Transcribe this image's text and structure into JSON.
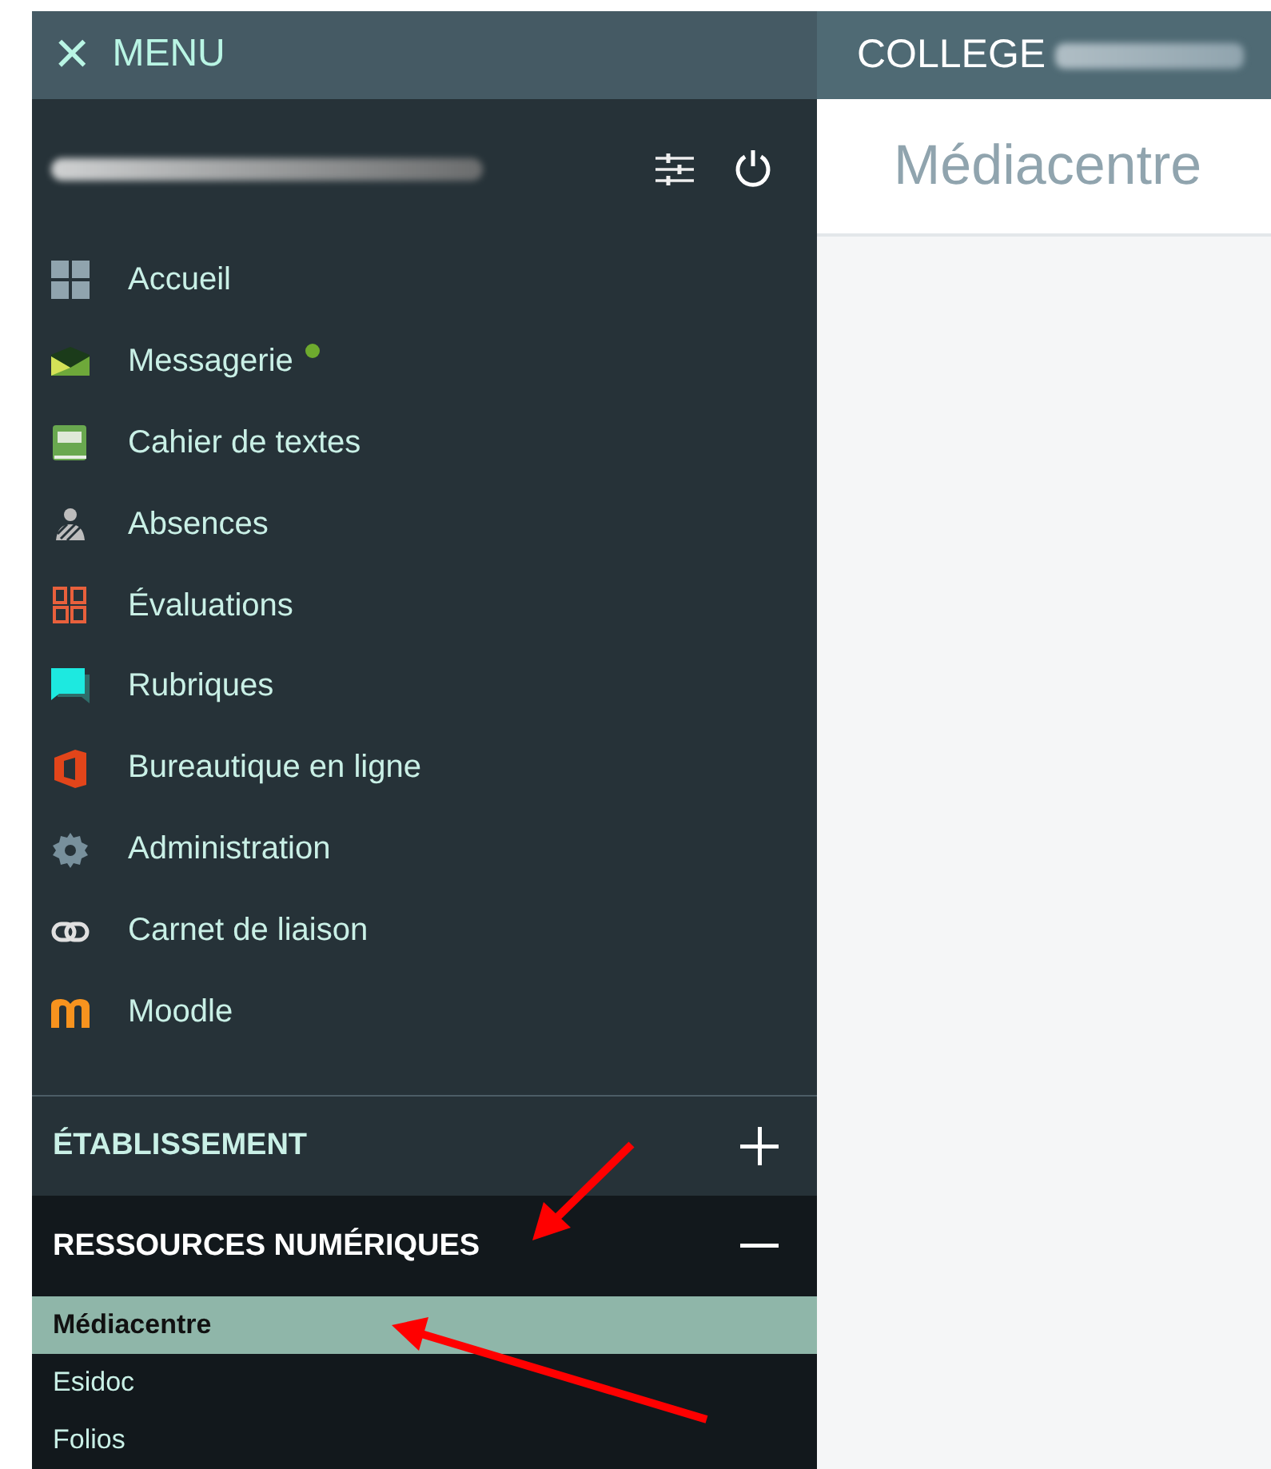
{
  "menu_bar": {
    "close_icon": "×",
    "label": "MENU"
  },
  "header": {
    "school_prefix": "COLLEGE"
  },
  "nav_items": [
    {
      "label": "Accueil",
      "notification": false
    },
    {
      "label": "Messagerie",
      "notification": true
    },
    {
      "label": "Cahier de textes",
      "notification": false
    },
    {
      "label": "Absences",
      "notification": false
    },
    {
      "label": "Évaluations",
      "notification": false
    },
    {
      "label": "Rubriques",
      "notification": false
    },
    {
      "label": "Bureautique en ligne",
      "notification": false
    },
    {
      "label": "Administration",
      "notification": false
    },
    {
      "label": "Carnet de liaison",
      "notification": false
    },
    {
      "label": "Moodle",
      "notification": false
    }
  ],
  "sections": [
    {
      "title": "ÉTABLISSEMENT",
      "expanded": false
    },
    {
      "title": "RESSOURCES NUMÉRIQUES",
      "expanded": true,
      "items": [
        {
          "label": "Médiacentre",
          "selected": true
        },
        {
          "label": "Esidoc",
          "selected": false
        },
        {
          "label": "Folios",
          "selected": false
        }
      ]
    }
  ],
  "page": {
    "title": "Médiacentre"
  }
}
